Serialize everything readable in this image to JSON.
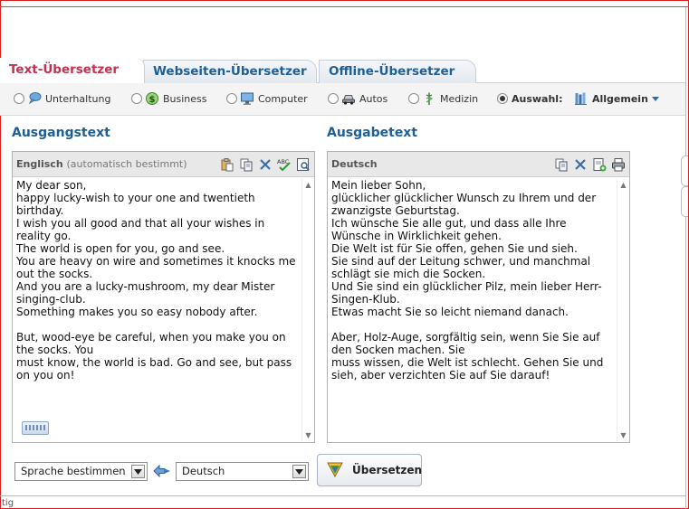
{
  "tabs": [
    {
      "label": "Text-Übersetzer"
    },
    {
      "label": "Webseiten-Übersetzer"
    },
    {
      "label": "Offline-Übersetzer"
    }
  ],
  "categories": [
    {
      "label": "Unterhaltung",
      "icon": "speech-bubble-icon",
      "selected": false
    },
    {
      "label": "Business",
      "icon": "dollar-coin-icon",
      "selected": false
    },
    {
      "label": "Computer",
      "icon": "monitor-icon",
      "selected": false
    },
    {
      "label": "Autos",
      "icon": "car-icon",
      "selected": false
    },
    {
      "label": "Medizin",
      "icon": "caduceus-icon",
      "selected": false
    },
    {
      "label": "Auswahl:",
      "icon": "",
      "selected": true
    }
  ],
  "auswahl_value": "Allgemein",
  "source": {
    "heading": "Ausgangstext",
    "language": "Englisch",
    "detected_note": "(automatisch bestimmt)",
    "text": "My dear son,\nhappy lucky-wish to your one and twentieth birthday.\nI wish you all good and that all your wishes in reality go.\nThe world is open for you, go and see.\nYou are heavy on wire and sometimes it knocks me out the socks.\nAnd you are a lucky-mushroom, my dear Mister singing-club.\nSomething makes you so easy nobody after.\n\nBut, wood-eye be careful, when you make you on the socks. You\nmust know, the world is bad. Go and see, but pass on you on!"
  },
  "target": {
    "heading": "Ausgabetext",
    "language": "Deutsch",
    "text": "Mein lieber Sohn,\nglücklicher glücklicher Wunsch zu Ihrem und der zwanzigste Geburtstag.\nIch wünsche Sie alle gut, und dass alle Ihre Wünsche in Wirklichkeit gehen.\nDie Welt ist für Sie offen, gehen Sie und sieh.\nSie sind auf der Leitung schwer, und manchmal schlägt sie mich die Socken.\nUnd Sie sind ein glücklicher Pilz, mein lieber Herr-Singen-Klub.\nEtwas macht Sie so leicht niemand danach.\n\nAber, Holz-Auge, sorgfältig sein, wenn Sie Sie auf den Socken machen. Sie\nmuss wissen, die Welt ist schlecht. Gehen Sie und sieh, aber verzichten Sie auf Sie darauf!"
  },
  "controls": {
    "source_select": "Sprache bestimmen",
    "target_select": "Deutsch",
    "translate_label": "Übersetzen"
  },
  "status_text": "tig",
  "colors": {
    "tab_active": "#c43050",
    "link_blue": "#1e5f96",
    "frame_red": "#d42020"
  }
}
